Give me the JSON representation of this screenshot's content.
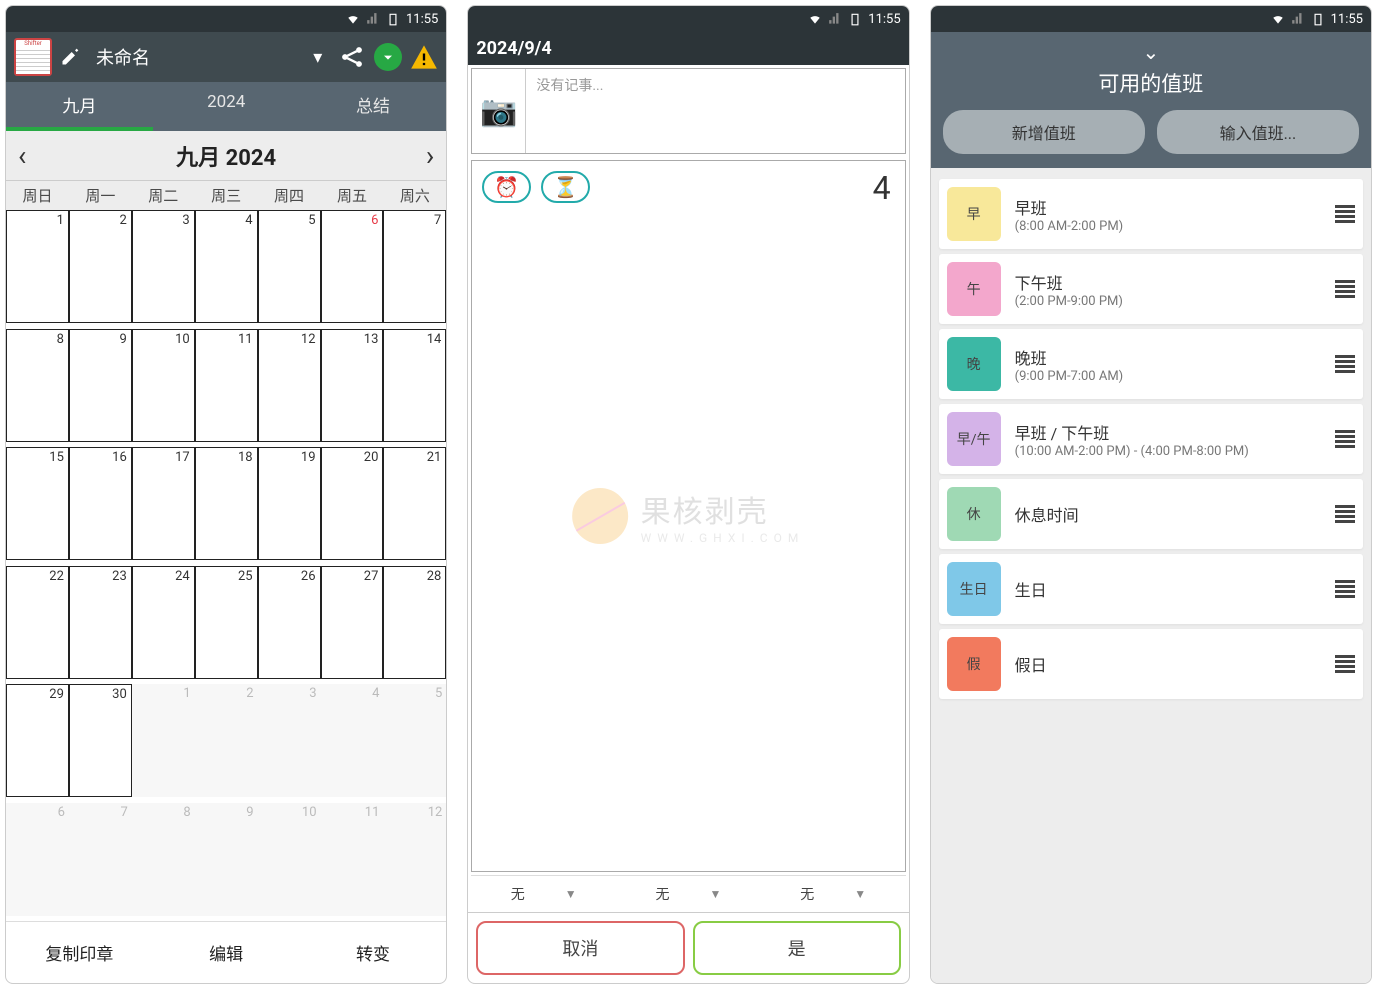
{
  "statusbar": {
    "time": "11:55"
  },
  "phone1": {
    "app_name": "未命名",
    "tabs": [
      "九月",
      "2024",
      "总结"
    ],
    "active_tab": 0,
    "month_title": "九月 2024",
    "weekdays": [
      "周日",
      "周一",
      "周二",
      "周三",
      "周四",
      "周五",
      "周六"
    ],
    "weeks": [
      [
        {
          "n": 1
        },
        {
          "n": 2
        },
        {
          "n": 3
        },
        {
          "n": 4
        },
        {
          "n": 5
        },
        {
          "n": 6,
          "red": true
        },
        {
          "n": 7
        }
      ],
      [
        {
          "n": 8
        },
        {
          "n": 9
        },
        {
          "n": 10
        },
        {
          "n": 11
        },
        {
          "n": 12
        },
        {
          "n": 13
        },
        {
          "n": 14
        }
      ],
      [
        {
          "n": 15
        },
        {
          "n": 16
        },
        {
          "n": 17
        },
        {
          "n": 18
        },
        {
          "n": 19
        },
        {
          "n": 20
        },
        {
          "n": 21
        }
      ],
      [
        {
          "n": 22
        },
        {
          "n": 23
        },
        {
          "n": 24
        },
        {
          "n": 25
        },
        {
          "n": 26
        },
        {
          "n": 27
        },
        {
          "n": 28
        }
      ],
      [
        {
          "n": 29
        },
        {
          "n": 30
        },
        {
          "n": 1,
          "out": true
        },
        {
          "n": 2,
          "out": true
        },
        {
          "n": 3,
          "out": true
        },
        {
          "n": 4,
          "out": true
        },
        {
          "n": 5,
          "out": true
        }
      ],
      [
        {
          "n": 6,
          "out": true
        },
        {
          "n": 7,
          "out": true
        },
        {
          "n": 8,
          "out": true
        },
        {
          "n": 9,
          "out": true
        },
        {
          "n": 10,
          "out": true
        },
        {
          "n": 11,
          "out": true
        },
        {
          "n": 12,
          "out": true
        }
      ]
    ],
    "bottom": [
      "复制印章",
      "编辑",
      "转变"
    ]
  },
  "phone2": {
    "date": "2024/9/4",
    "note_placeholder": "没有记事...",
    "day_number": "4",
    "watermark_main": "果核剥壳",
    "watermark_sub": "WWW.GHXI.COM",
    "spinner_value": "无",
    "cancel": "取消",
    "ok": "是"
  },
  "phone3": {
    "title": "可用的值班",
    "btn_add": "新增值班",
    "btn_import": "输入值班...",
    "shifts": [
      {
        "badge": "早",
        "color": "#f8e89a",
        "name": "早班",
        "time": "(8:00 AM-2:00 PM)"
      },
      {
        "badge": "午",
        "color": "#f3a7cc",
        "name": "下午班",
        "time": "(2:00 PM-9:00 PM)"
      },
      {
        "badge": "晚",
        "color": "#3cb8a5",
        "name": "晚班",
        "time": "(9:00 PM-7:00 AM)"
      },
      {
        "badge": "早/午",
        "color": "#d4b3e8",
        "name": "早班 / 下午班",
        "time": "(10:00 AM-2:00 PM) - (4:00 PM-8:00 PM)"
      },
      {
        "badge": "休",
        "color": "#9fd9b4",
        "name": "休息时间",
        "time": ""
      },
      {
        "badge": "生日",
        "color": "#7fc8e8",
        "name": "生日",
        "time": ""
      },
      {
        "badge": "假",
        "color": "#f27a5e",
        "name": "假日",
        "time": ""
      }
    ]
  }
}
